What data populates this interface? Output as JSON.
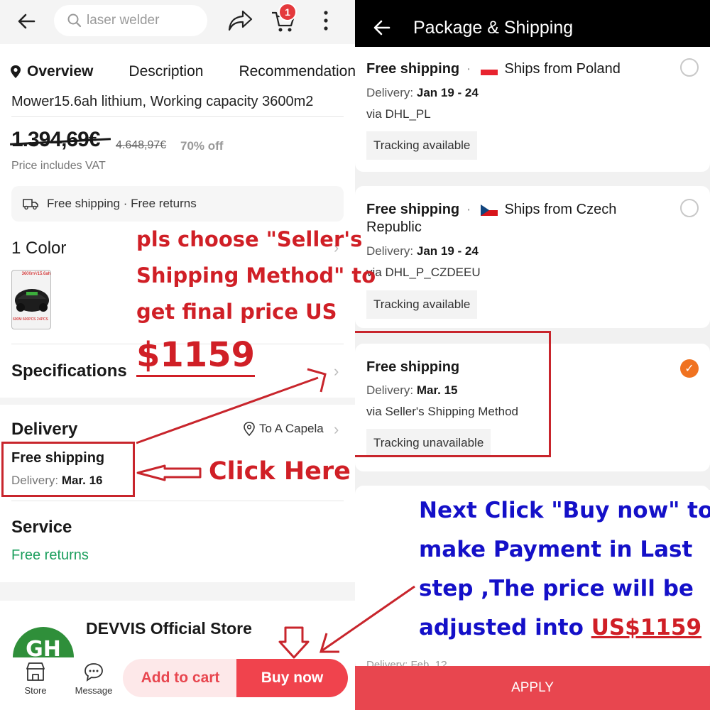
{
  "left": {
    "search": {
      "placeholder": "laser welder"
    },
    "cart": {
      "badge": "1"
    },
    "tabs": [
      "Overview",
      "Description",
      "Recommendations"
    ],
    "product": {
      "title_fragment": "Mower15.6ah lithium, Working capacity 3600m2",
      "price": "1.394,69€",
      "original_price": "4.648,97€",
      "discount": "70% off",
      "vat_note": "Price includes VAT"
    },
    "shipping_strip": "Free shipping · Free returns",
    "color": {
      "title": "1 Color",
      "thumb_caption": "3600m²/15.6ah",
      "thumb_footer": "600M   600PCS   24PCS"
    },
    "specifications": {
      "title": "Specifications"
    },
    "delivery": {
      "title": "Delivery",
      "location": "To A Capela",
      "method": "Free shipping",
      "date_label": "Delivery:",
      "date": "Mar. 16"
    },
    "service": {
      "title": "Service",
      "value": "Free returns"
    },
    "store": {
      "name": "DEVVIS Official Store"
    },
    "bottom_nav": {
      "store": "Store",
      "message": "Message",
      "add_to_cart": "Add to cart",
      "buy_now": "Buy now"
    }
  },
  "right": {
    "header": {
      "title": "Package & Shipping"
    },
    "options": [
      {
        "title": "Free shipping",
        "ships_from": "Ships from Poland",
        "date_label": "Delivery:",
        "date": "Jan 19 - 24",
        "via": "via DHL_PL",
        "tracking": "Tracking available",
        "selected": false
      },
      {
        "title": "Free shipping",
        "ships_from": "Ships from Czech",
        "ships_from_2": "Republic",
        "date_label": "Delivery:",
        "date": "Jan 19 - 24",
        "via": "via DHL_P_CZDEEU",
        "tracking": "Tracking available",
        "selected": false
      },
      {
        "title": "Free shipping",
        "date_label": "Delivery:",
        "date": "Mar. 15",
        "via": "via Seller's Shipping Method",
        "tracking": "Tracking unavailable",
        "selected": true
      }
    ],
    "partial_row": "Delivery: Feb. 1?",
    "apply": "APPLY"
  },
  "annotations": {
    "choose_lines": [
      "pls choose \"Seller's",
      "Shipping Method\" to",
      "get final price US"
    ],
    "price": "$1159",
    "click_here": "Click Here",
    "next_lines": [
      "Next Click \"Buy now\" to",
      "make Payment in Last",
      "step ,The price will be"
    ],
    "adjusted": "adjusted into ",
    "adjusted_price": "US$1159"
  },
  "colors": {
    "accent_red": "#e4393c",
    "annotation_red": "#d01f26",
    "annotation_blue": "#1410c8",
    "apply_bg": "#e8464f",
    "selected_radio": "#f07220",
    "free_returns_green": "#1a9e5c"
  }
}
